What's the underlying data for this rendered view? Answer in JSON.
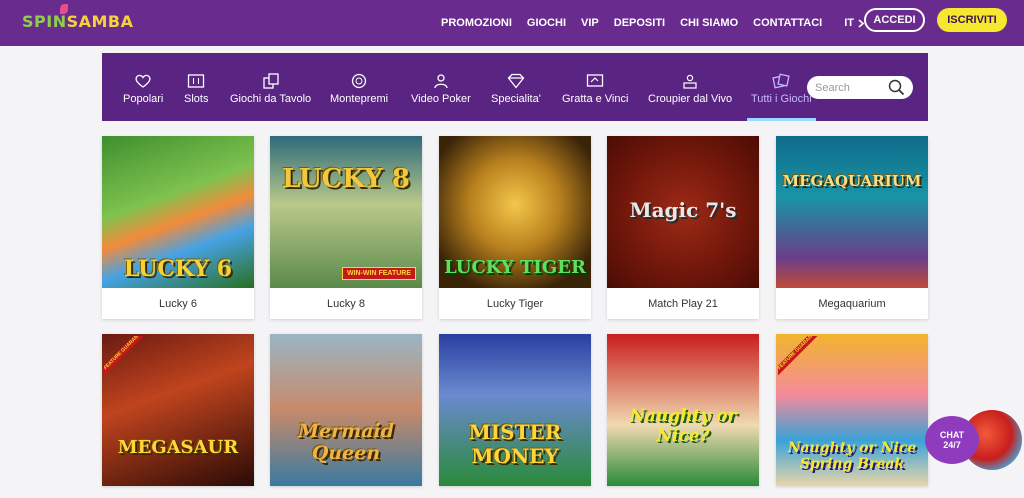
{
  "logo": {
    "part1": "SPIN",
    "part2": "SAMBA"
  },
  "top_nav": {
    "items": [
      "PROMOZIONI",
      "GIOCHI",
      "VIP",
      "DEPOSITI",
      "CHI SIAMO",
      "CONTATTACI"
    ],
    "language": "IT"
  },
  "auth": {
    "login": "ACCEDI",
    "signup": "ISCRIVITI"
  },
  "categories": [
    {
      "label": "Popolari",
      "icon": "heart-icon"
    },
    {
      "label": "Slots",
      "icon": "slot-machine-icon"
    },
    {
      "label": "Giochi da Tavolo",
      "icon": "cards-icon"
    },
    {
      "label": "Montepremi",
      "icon": "jackpot-icon"
    },
    {
      "label": "Video Poker",
      "icon": "player-icon"
    },
    {
      "label": "Specialita'",
      "icon": "diamond-icon"
    },
    {
      "label": "Gratta e Vinci",
      "icon": "scratch-card-icon"
    },
    {
      "label": "Croupier dal Vivo",
      "icon": "dealer-icon"
    },
    {
      "label": "Tutti i Giochi",
      "icon": "all-games-icon",
      "active": true
    }
  ],
  "search": {
    "placeholder": "Search"
  },
  "games": [
    {
      "name": "Lucky 6",
      "art": "LUCKY 6"
    },
    {
      "name": "Lucky 8",
      "art": "LUCKY 8",
      "badge": "WIN-WIN FEATURE"
    },
    {
      "name": "Lucky Tiger",
      "art": "LUCKY TIGER"
    },
    {
      "name": "Match Play 21",
      "art": "Magic 7's"
    },
    {
      "name": "Megaquarium",
      "art": "MEGAQUARIUM"
    },
    {
      "name": "",
      "art": "MEGASAUR",
      "banner": "FEATURE GUARANTEE"
    },
    {
      "name": "",
      "art": "Mermaid Queen"
    },
    {
      "name": "",
      "art": "MISTER MONEY"
    },
    {
      "name": "",
      "art": "Naughty or Nice?"
    },
    {
      "name": "",
      "art": "Naughty or Nice Spring Break",
      "banner": "FEATURE GUARANTEE"
    }
  ],
  "chat": {
    "line1": "CHAT",
    "line2": "24/7"
  },
  "colors": {
    "header": "#6a2b8f",
    "category_bar": "#5a2483",
    "signup_button": "#f6e830",
    "active_underline": "#9ad8ff"
  }
}
